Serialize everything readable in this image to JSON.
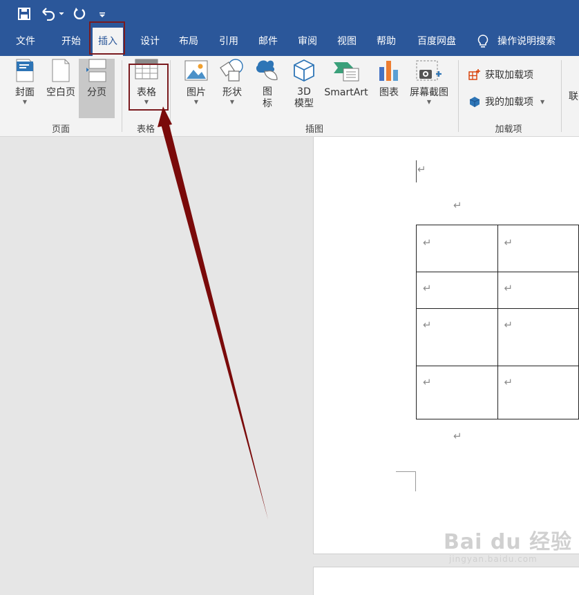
{
  "quick_access": {
    "save": "save-icon",
    "undo": "undo-icon",
    "redo": "redo-icon",
    "customize": "customize-icon"
  },
  "tabs": [
    {
      "label": "文件"
    },
    {
      "label": "开始"
    },
    {
      "label": "插入",
      "active": true
    },
    {
      "label": "设计"
    },
    {
      "label": "布局"
    },
    {
      "label": "引用"
    },
    {
      "label": "邮件"
    },
    {
      "label": "审阅"
    },
    {
      "label": "视图"
    },
    {
      "label": "帮助"
    },
    {
      "label": "百度网盘"
    }
  ],
  "tell_me": {
    "icon": "lightbulb-icon",
    "label": "操作说明搜索"
  },
  "ribbon": {
    "pages": {
      "label": "页面",
      "cover": "封面",
      "blank": "空白页",
      "break": "分页"
    },
    "tables": {
      "label": "表格",
      "table": "表格"
    },
    "illustrations": {
      "label": "插图",
      "pictures": "图片",
      "shapes": "形状",
      "icons_line1": "图",
      "icons_line2": "标",
      "model_line1": "3D",
      "model_line2": "模型",
      "smartart": "SmartArt",
      "chart": "图表",
      "screenshot": "屏幕截图"
    },
    "addins": {
      "label": "加载项",
      "get": "获取加载项",
      "mine": "我的加载项"
    },
    "cut_off": "联"
  },
  "document": {
    "paragraph_mark": "↵",
    "table_rows": 4,
    "table_cols": 2
  },
  "colors": {
    "accent": "#2b579a",
    "highlight": "#7a1a1e",
    "arrow": "#7a0a0a"
  },
  "watermark": {
    "line1": "Bai du 经验",
    "line2": "jingyan.baidu.com"
  }
}
